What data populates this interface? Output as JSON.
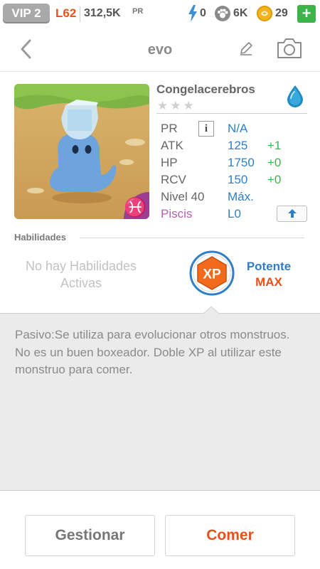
{
  "status_bar": {
    "vip": "VIP 2",
    "level": "L62",
    "pr_amount": "312,5K",
    "pr_unit": "PR",
    "energy": "0",
    "paws": "6K",
    "coins": "29",
    "add_label": "+",
    "icons": [
      "energy-icon",
      "paw-icon",
      "coin-icon"
    ]
  },
  "header": {
    "title": "evo",
    "icons": [
      "back-icon",
      "edit-icon",
      "camera-icon"
    ]
  },
  "monster": {
    "name": "Congelacerebros",
    "stars": "★★★",
    "element_icon": "water-drop-icon",
    "zodiac_symbol": "♓",
    "stats": [
      {
        "label": "PR",
        "value": "N/A",
        "bonus": ""
      },
      {
        "label": "ATK",
        "value": "125",
        "bonus": "+1"
      },
      {
        "label": "HP",
        "value": "1750",
        "bonus": "+0"
      },
      {
        "label": "RCV",
        "value": "150",
        "bonus": "+0"
      },
      {
        "label": "Nivel 40",
        "value": "Máx.",
        "bonus": ""
      },
      {
        "label": "Piscis",
        "value": "L0",
        "bonus": ""
      }
    ],
    "info_glyph": "i",
    "upgrade_glyph": "🡅"
  },
  "colors": {
    "accent_orange": "#e8511b",
    "accent_blue": "#2e7fc7",
    "bonus_green": "#3db44a",
    "zodiac_purple": "#b95fb0"
  },
  "abilities": {
    "title": "Habilidades",
    "none_text": "No hay Habilidades Activas",
    "passive_badge": "XP",
    "passive_name": "Potente",
    "passive_level": "MAX"
  },
  "description": "Pasivo:Se utiliza para evolucionar otros monstruos. No es un buen boxeador. Doble XP al utilizar este monstruo para comer.",
  "actions": {
    "manage": "Gestionar",
    "eat": "Comer"
  }
}
